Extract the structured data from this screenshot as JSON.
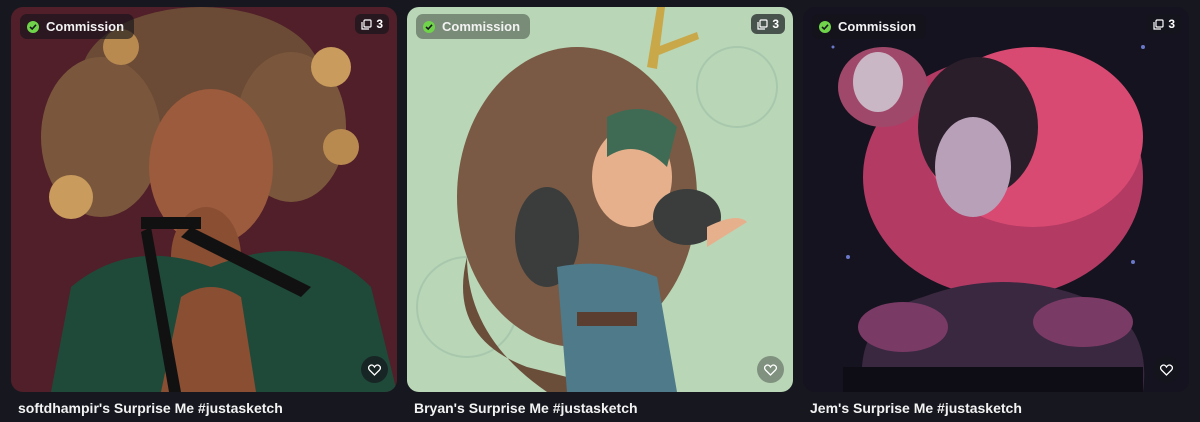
{
  "cards": [
    {
      "badge_label": "Commission",
      "image_count": "3",
      "title": "softdhampir's Surprise Me #justasketch",
      "badge_icon": "verified-check-icon",
      "count_icon": "image-stack-icon",
      "like_icon": "heart-icon",
      "background_color": "#4a1d26"
    },
    {
      "badge_label": "Commission",
      "image_count": "3",
      "title": "Bryan's Surprise Me #justasketch",
      "badge_icon": "verified-check-icon",
      "count_icon": "image-stack-icon",
      "like_icon": "heart-icon",
      "background_color": "#b9d6b7"
    },
    {
      "badge_label": "Commission",
      "image_count": "3",
      "title": "Jem's Surprise Me #justasketch",
      "badge_icon": "verified-check-icon",
      "count_icon": "image-stack-icon",
      "like_icon": "heart-icon",
      "background_color": "#15131f"
    }
  ],
  "colors": {
    "page_background": "#17181f",
    "commission_check": "#6fd44a"
  }
}
